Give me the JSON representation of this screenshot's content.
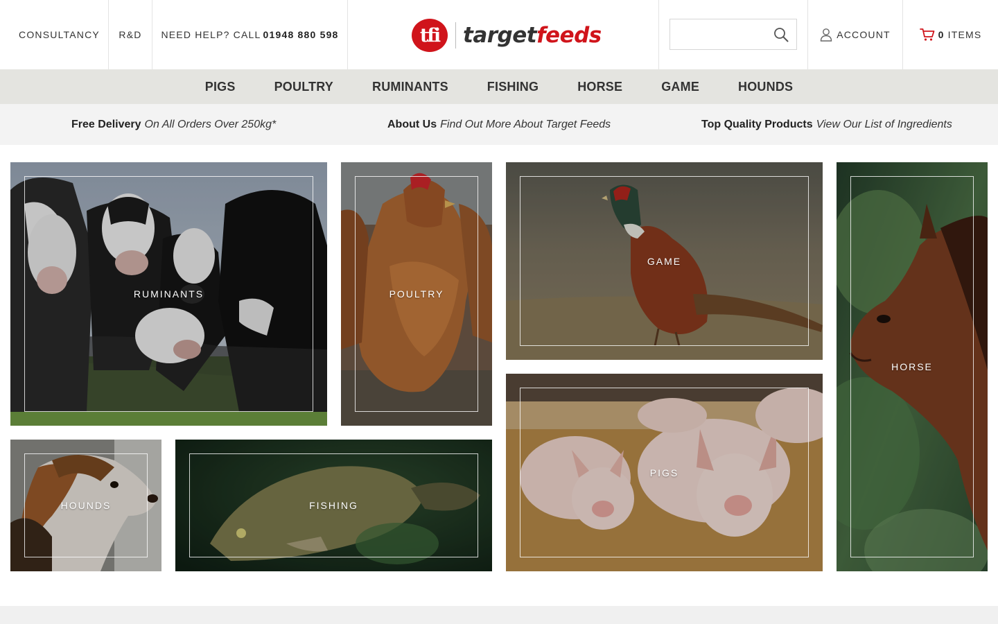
{
  "header": {
    "consultancy": "CONSULTANCY",
    "rnd": "R&D",
    "help_text": "NEED HELP? CALL",
    "phone": "01948 880 598",
    "account": "ACCOUNT",
    "cart_count": "0",
    "cart_label": "ITEMS",
    "search_placeholder": ""
  },
  "logo": {
    "badge": "tfi",
    "word_a": "target",
    "word_b": "feeds"
  },
  "nav": [
    "PIGS",
    "POULTRY",
    "RUMINANTS",
    "FISHING",
    "HORSE",
    "GAME",
    "HOUNDS"
  ],
  "info": [
    {
      "strong": "Free Delivery",
      "em": "On All Orders Over 250kg*"
    },
    {
      "strong": "About Us",
      "em": "Find Out More About Target Feeds"
    },
    {
      "strong": "Top Quality Products",
      "em": "View Our List of Ingredients"
    }
  ],
  "tiles": {
    "ruminants": "RUMINANTS",
    "poultry": "POULTRY",
    "game": "GAME",
    "horse": "HORSE",
    "hounds": "HOUNDS",
    "fishing": "FISHING",
    "pigs": "PIGS"
  },
  "colors": {
    "brand_red": "#d0141b",
    "nav_bg": "#e4e4e0",
    "strip_bg": "#f3f3f3"
  }
}
